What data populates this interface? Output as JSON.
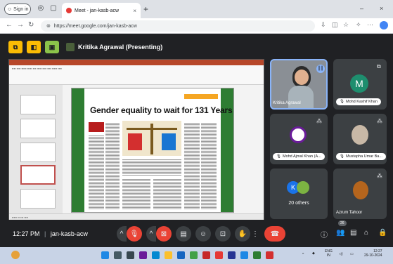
{
  "browser": {
    "signin_label": "Sign in",
    "tab_title": "Meet - jan-kasb-acw",
    "tab_close": "×",
    "new_tab": "+",
    "url": "https://meet.google.com/jan-kasb-acw",
    "window_min": "–",
    "window_close": "×"
  },
  "presenter": {
    "name": "Kritika Agrawal (Presenting)"
  },
  "slide": {
    "headline": "Gender equality to wait for 131 Years"
  },
  "participants": {
    "main": {
      "name": "Kritika Agrawal"
    },
    "mohd_kashif": {
      "initial": "M",
      "name": "Mohd Kashif Khan",
      "color": "#1e8e6e"
    },
    "mohd_ajmal": {
      "name": "Mohd Ajmal Khan (A..."
    },
    "mustapha": {
      "name": "Mustapha Umar Ba..."
    },
    "others": {
      "initial": "K",
      "label": "20 others"
    },
    "azrum": {
      "name": "Azrum Tahoor"
    }
  },
  "meeting": {
    "time": "12:27 PM",
    "code": "jan-kasb-acw",
    "people_count": "26"
  },
  "taskbar": {
    "lang_top": "ENG",
    "lang_bottom": "IN",
    "time": "12:27",
    "date": "29-10-2024"
  }
}
